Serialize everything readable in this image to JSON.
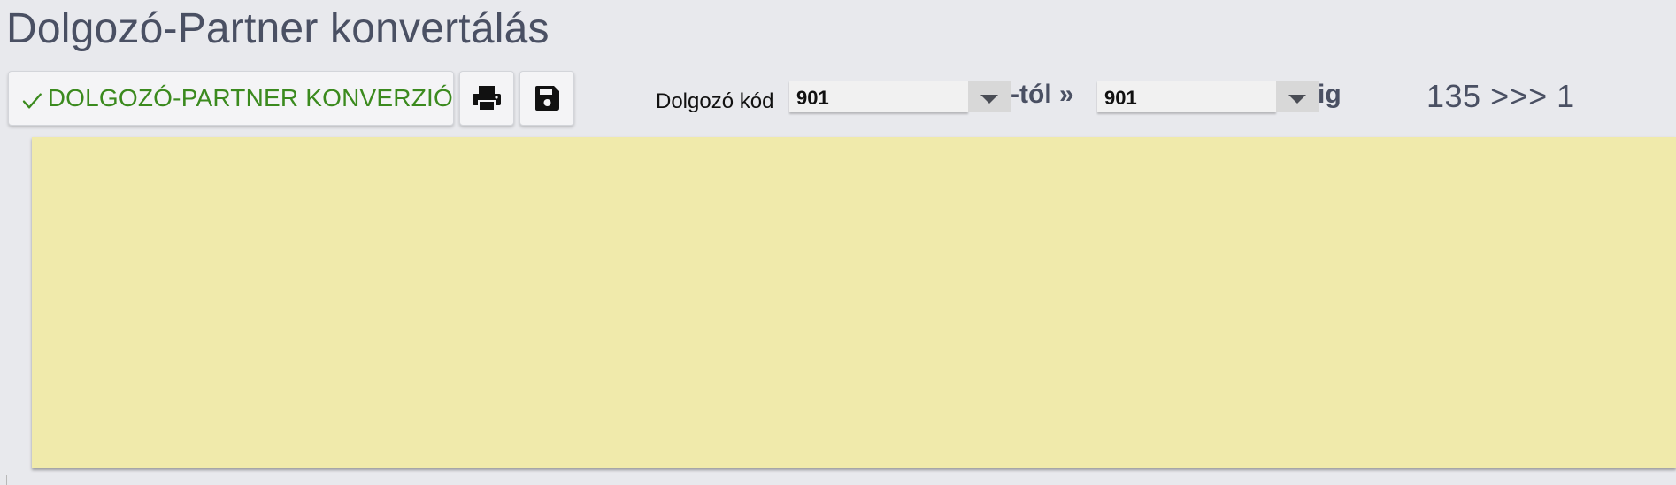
{
  "page": {
    "title": "Dolgozó-Partner konvertálás"
  },
  "toolbar": {
    "convert_label": "DOLGOZÓ-PARTNER KONVERZIÓ",
    "convert_icon": "check-icon",
    "print_icon": "printer-icon",
    "save_icon": "floppy-disk-icon",
    "accent_color": "#3b8a1e"
  },
  "filter": {
    "label": "Dolgozó kód",
    "from_value": "901",
    "from_suffix": "-tól »",
    "to_value": "901",
    "to_suffix": "ig"
  },
  "status": {
    "counter": "135 >>> 1"
  },
  "result_panel": {
    "background_color": "#f0eaab"
  }
}
